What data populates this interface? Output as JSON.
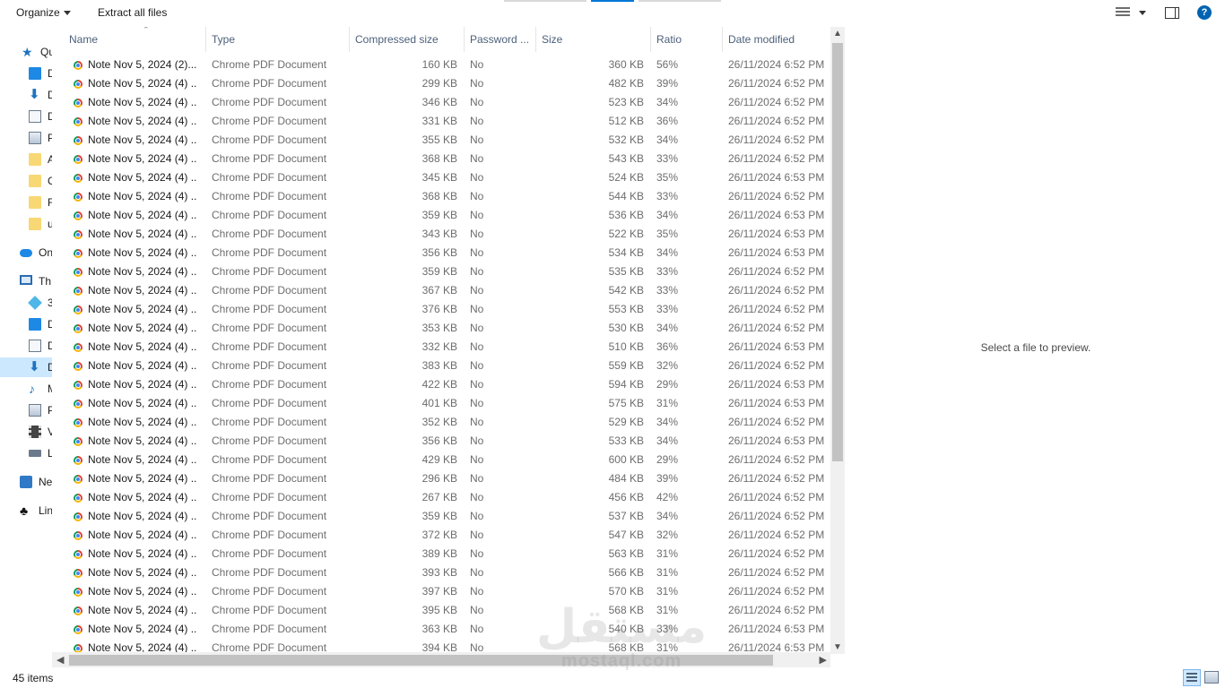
{
  "toolbar": {
    "organize_label": "Organize",
    "extract_label": "Extract all files",
    "help_label": "?"
  },
  "nav": [
    {
      "label": "Qu",
      "icon": "star-icon"
    },
    {
      "label": "D",
      "icon": "desktop-icon"
    },
    {
      "label": "D",
      "icon": "download-icon"
    },
    {
      "label": "D",
      "icon": "document-icon"
    },
    {
      "label": "P",
      "icon": "pictures-icon"
    },
    {
      "label": "A",
      "icon": "folder-icon"
    },
    {
      "label": "C",
      "icon": "folder-icon"
    },
    {
      "label": "F",
      "icon": "folder-icon"
    },
    {
      "label": "u",
      "icon": "folder-icon"
    },
    {
      "label": "On",
      "icon": "onedrive-icon"
    },
    {
      "label": "Th",
      "icon": "this-pc-icon"
    },
    {
      "label": "3",
      "icon": "3d-objects-icon"
    },
    {
      "label": "D",
      "icon": "desktop-icon"
    },
    {
      "label": "D",
      "icon": "document-icon"
    },
    {
      "label": "D",
      "icon": "download-icon"
    },
    {
      "label": "M",
      "icon": "music-icon"
    },
    {
      "label": "P",
      "icon": "pictures-icon"
    },
    {
      "label": "V",
      "icon": "video-icon"
    },
    {
      "label": "L",
      "icon": "drive-icon"
    },
    {
      "label": "Ne",
      "icon": "network-icon"
    },
    {
      "label": "Lin",
      "icon": "linux-icon"
    }
  ],
  "columns": [
    "Name",
    "Type",
    "Compressed size",
    "Password ...",
    "Size",
    "Ratio",
    "Date modified"
  ],
  "files": [
    {
      "name": "Note Nov 5, 2024 (2)....",
      "type": "Chrome PDF Document",
      "compressed": "160 KB",
      "password": "No",
      "size": "360 KB",
      "ratio": "56%",
      "date": "26/11/2024 6:52 PM"
    },
    {
      "name": "Note Nov 5, 2024 (4) ...",
      "type": "Chrome PDF Document",
      "compressed": "299 KB",
      "password": "No",
      "size": "482 KB",
      "ratio": "39%",
      "date": "26/11/2024 6:52 PM"
    },
    {
      "name": "Note Nov 5, 2024 (4) ...",
      "type": "Chrome PDF Document",
      "compressed": "346 KB",
      "password": "No",
      "size": "523 KB",
      "ratio": "34%",
      "date": "26/11/2024 6:52 PM"
    },
    {
      "name": "Note Nov 5, 2024 (4) ...",
      "type": "Chrome PDF Document",
      "compressed": "331 KB",
      "password": "No",
      "size": "512 KB",
      "ratio": "36%",
      "date": "26/11/2024 6:52 PM"
    },
    {
      "name": "Note Nov 5, 2024 (4) ...",
      "type": "Chrome PDF Document",
      "compressed": "355 KB",
      "password": "No",
      "size": "532 KB",
      "ratio": "34%",
      "date": "26/11/2024 6:52 PM"
    },
    {
      "name": "Note Nov 5, 2024 (4) ...",
      "type": "Chrome PDF Document",
      "compressed": "368 KB",
      "password": "No",
      "size": "543 KB",
      "ratio": "33%",
      "date": "26/11/2024 6:52 PM"
    },
    {
      "name": "Note Nov 5, 2024 (4) ...",
      "type": "Chrome PDF Document",
      "compressed": "345 KB",
      "password": "No",
      "size": "524 KB",
      "ratio": "35%",
      "date": "26/11/2024 6:53 PM"
    },
    {
      "name": "Note Nov 5, 2024 (4) ...",
      "type": "Chrome PDF Document",
      "compressed": "368 KB",
      "password": "No",
      "size": "544 KB",
      "ratio": "33%",
      "date": "26/11/2024 6:52 PM"
    },
    {
      "name": "Note Nov 5, 2024 (4) ...",
      "type": "Chrome PDF Document",
      "compressed": "359 KB",
      "password": "No",
      "size": "536 KB",
      "ratio": "34%",
      "date": "26/11/2024 6:53 PM"
    },
    {
      "name": "Note Nov 5, 2024 (4) ...",
      "type": "Chrome PDF Document",
      "compressed": "343 KB",
      "password": "No",
      "size": "522 KB",
      "ratio": "35%",
      "date": "26/11/2024 6:53 PM"
    },
    {
      "name": "Note Nov 5, 2024 (4) ...",
      "type": "Chrome PDF Document",
      "compressed": "356 KB",
      "password": "No",
      "size": "534 KB",
      "ratio": "34%",
      "date": "26/11/2024 6:53 PM"
    },
    {
      "name": "Note Nov 5, 2024 (4) ...",
      "type": "Chrome PDF Document",
      "compressed": "359 KB",
      "password": "No",
      "size": "535 KB",
      "ratio": "33%",
      "date": "26/11/2024 6:52 PM"
    },
    {
      "name": "Note Nov 5, 2024 (4) ...",
      "type": "Chrome PDF Document",
      "compressed": "367 KB",
      "password": "No",
      "size": "542 KB",
      "ratio": "33%",
      "date": "26/11/2024 6:52 PM"
    },
    {
      "name": "Note Nov 5, 2024 (4) ...",
      "type": "Chrome PDF Document",
      "compressed": "376 KB",
      "password": "No",
      "size": "553 KB",
      "ratio": "33%",
      "date": "26/11/2024 6:52 PM"
    },
    {
      "name": "Note Nov 5, 2024 (4) ...",
      "type": "Chrome PDF Document",
      "compressed": "353 KB",
      "password": "No",
      "size": "530 KB",
      "ratio": "34%",
      "date": "26/11/2024 6:52 PM"
    },
    {
      "name": "Note Nov 5, 2024 (4) ...",
      "type": "Chrome PDF Document",
      "compressed": "332 KB",
      "password": "No",
      "size": "510 KB",
      "ratio": "36%",
      "date": "26/11/2024 6:53 PM"
    },
    {
      "name": "Note Nov 5, 2024 (4) ...",
      "type": "Chrome PDF Document",
      "compressed": "383 KB",
      "password": "No",
      "size": "559 KB",
      "ratio": "32%",
      "date": "26/11/2024 6:52 PM"
    },
    {
      "name": "Note Nov 5, 2024 (4) ...",
      "type": "Chrome PDF Document",
      "compressed": "422 KB",
      "password": "No",
      "size": "594 KB",
      "ratio": "29%",
      "date": "26/11/2024 6:53 PM"
    },
    {
      "name": "Note Nov 5, 2024 (4) ...",
      "type": "Chrome PDF Document",
      "compressed": "401 KB",
      "password": "No",
      "size": "575 KB",
      "ratio": "31%",
      "date": "26/11/2024 6:53 PM"
    },
    {
      "name": "Note Nov 5, 2024 (4) ...",
      "type": "Chrome PDF Document",
      "compressed": "352 KB",
      "password": "No",
      "size": "529 KB",
      "ratio": "34%",
      "date": "26/11/2024 6:52 PM"
    },
    {
      "name": "Note Nov 5, 2024 (4) ...",
      "type": "Chrome PDF Document",
      "compressed": "356 KB",
      "password": "No",
      "size": "533 KB",
      "ratio": "34%",
      "date": "26/11/2024 6:53 PM"
    },
    {
      "name": "Note Nov 5, 2024 (4) ...",
      "type": "Chrome PDF Document",
      "compressed": "429 KB",
      "password": "No",
      "size": "600 KB",
      "ratio": "29%",
      "date": "26/11/2024 6:52 PM"
    },
    {
      "name": "Note Nov 5, 2024 (4) ...",
      "type": "Chrome PDF Document",
      "compressed": "296 KB",
      "password": "No",
      "size": "484 KB",
      "ratio": "39%",
      "date": "26/11/2024 6:52 PM"
    },
    {
      "name": "Note Nov 5, 2024 (4) ...",
      "type": "Chrome PDF Document",
      "compressed": "267 KB",
      "password": "No",
      "size": "456 KB",
      "ratio": "42%",
      "date": "26/11/2024 6:52 PM"
    },
    {
      "name": "Note Nov 5, 2024 (4) ...",
      "type": "Chrome PDF Document",
      "compressed": "359 KB",
      "password": "No",
      "size": "537 KB",
      "ratio": "34%",
      "date": "26/11/2024 6:52 PM"
    },
    {
      "name": "Note Nov 5, 2024 (4) ...",
      "type": "Chrome PDF Document",
      "compressed": "372 KB",
      "password": "No",
      "size": "547 KB",
      "ratio": "32%",
      "date": "26/11/2024 6:52 PM"
    },
    {
      "name": "Note Nov 5, 2024 (4) ...",
      "type": "Chrome PDF Document",
      "compressed": "389 KB",
      "password": "No",
      "size": "563 KB",
      "ratio": "31%",
      "date": "26/11/2024 6:52 PM"
    },
    {
      "name": "Note Nov 5, 2024 (4) ...",
      "type": "Chrome PDF Document",
      "compressed": "393 KB",
      "password": "No",
      "size": "566 KB",
      "ratio": "31%",
      "date": "26/11/2024 6:52 PM"
    },
    {
      "name": "Note Nov 5, 2024 (4) ...",
      "type": "Chrome PDF Document",
      "compressed": "397 KB",
      "password": "No",
      "size": "570 KB",
      "ratio": "31%",
      "date": "26/11/2024 6:52 PM"
    },
    {
      "name": "Note Nov 5, 2024 (4) ...",
      "type": "Chrome PDF Document",
      "compressed": "395 KB",
      "password": "No",
      "size": "568 KB",
      "ratio": "31%",
      "date": "26/11/2024 6:52 PM"
    },
    {
      "name": "Note Nov 5, 2024 (4) ...",
      "type": "Chrome PDF Document",
      "compressed": "363 KB",
      "password": "No",
      "size": "540 KB",
      "ratio": "33%",
      "date": "26/11/2024 6:53 PM"
    },
    {
      "name": "Note Nov 5, 2024 (4) ...",
      "type": "Chrome PDF Document",
      "compressed": "394 KB",
      "password": "No",
      "size": "568 KB",
      "ratio": "31%",
      "date": "26/11/2024 6:53 PM"
    }
  ],
  "preview": {
    "message": "Select a file to preview."
  },
  "status": {
    "item_count": "45 items"
  },
  "watermark": {
    "arabic": "مستقل",
    "latin": "mostaql.com"
  },
  "colors": {
    "accent": "#0078d7",
    "header_text": "#4c607a",
    "selected_nav": "#cce8ff"
  }
}
